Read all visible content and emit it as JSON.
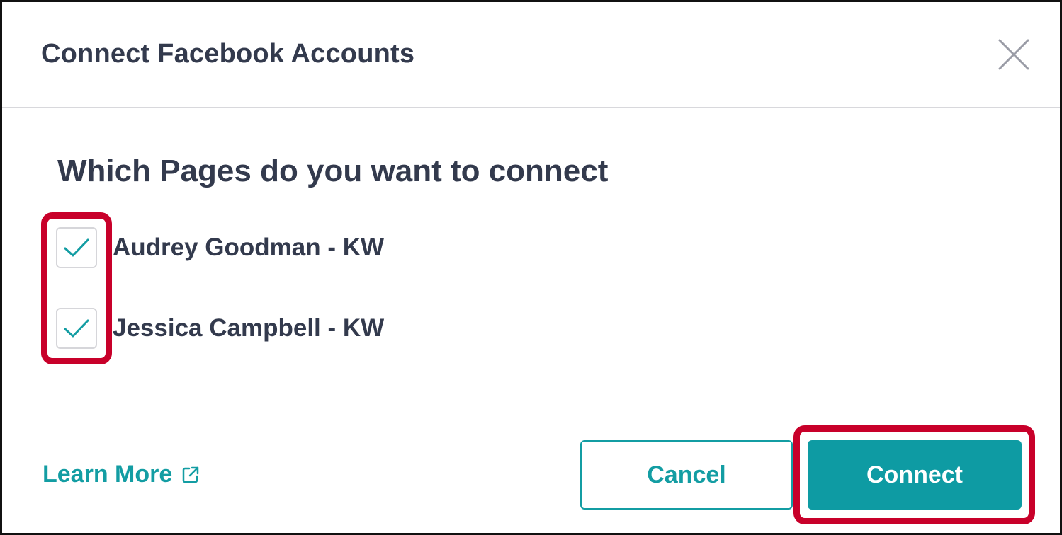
{
  "dialog": {
    "title": "Connect Facebook Accounts",
    "question": "Which Pages do you want to connect",
    "pages": [
      {
        "label": "Audrey Goodman - KW",
        "checked": true
      },
      {
        "label": "Jessica Campbell - KW",
        "checked": true
      }
    ],
    "learn_more": "Learn More",
    "cancel_label": "Cancel",
    "connect_label": "Connect"
  },
  "colors": {
    "accent": "#0e9ba3",
    "text": "#333a4d",
    "highlight": "#c8002a"
  },
  "icons": {
    "close": "close-icon",
    "check": "checkmark-icon",
    "external": "external-link-icon"
  }
}
